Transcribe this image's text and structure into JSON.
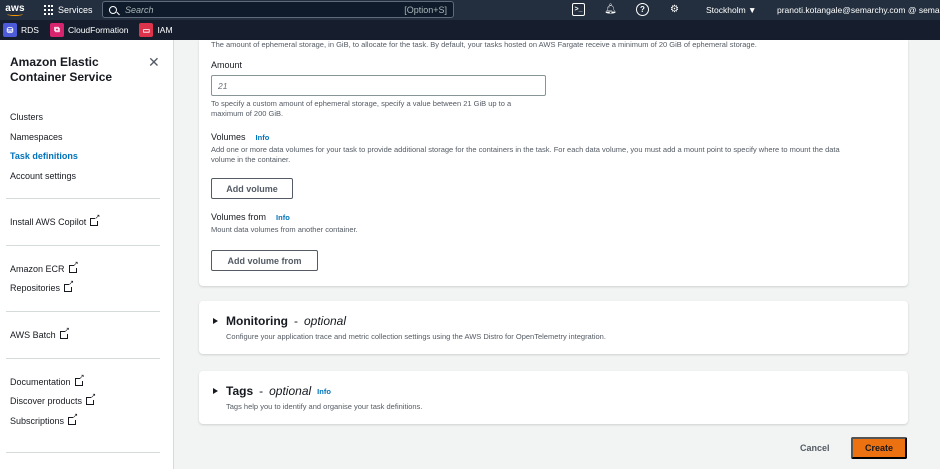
{
  "topbar": {
    "logo": "aws",
    "services_label": "Services",
    "search_placeholder": "Search",
    "search_shortcut": "[Option+S]",
    "region": "Stockholm ▼",
    "user": "pranoti.kotangale@semarchy.com @ semarch"
  },
  "favorites": [
    {
      "label": "RDS",
      "color": "#4d5bd9",
      "icon": "rds-icon"
    },
    {
      "label": "CloudFormation",
      "color": "#d6246e",
      "icon": "cloudformation-icon"
    },
    {
      "label": "IAM",
      "color": "#dd344c",
      "icon": "iam-icon"
    }
  ],
  "sidebar": {
    "title": "Amazon Elastic Container Service",
    "items": [
      "Clusters",
      "Namespaces",
      "Task definitions",
      "Account settings"
    ],
    "copilot": "Install AWS Copilot",
    "ecr": [
      "Amazon ECR",
      "Repositories"
    ],
    "batch": "AWS Batch",
    "docs": [
      "Documentation",
      "Discover products",
      "Subscriptions"
    ]
  },
  "storage": {
    "top_text": "The amount of ephemeral storage, in GiB, to allocate for the task. By default, your tasks hosted on AWS Fargate receive a minimum of 20 GiB of ephemeral storage.",
    "amount_label": "Amount",
    "amount_value": "21",
    "amount_help_1": "To specify a custom amount of ephemeral storage, specify a value between 21 GiB up to a",
    "amount_help_2": "maximum of 200 GiB."
  },
  "volumes": {
    "label": "Volumes",
    "info": "Info",
    "desc_1": "Add one or more data volumes for your task to provide additional storage for the containers in the task. For each data volume, you must add a mount point to specify where to mount the data",
    "desc_2": "volume in the container.",
    "add_button": "Add volume"
  },
  "volumes_from": {
    "label": "Volumes from",
    "info": "Info",
    "desc": "Mount data volumes from another container.",
    "add_button": "Add volume from"
  },
  "monitoring": {
    "title": "Monitoring",
    "optional": "optional",
    "desc": "Configure your application trace and metric collection settings using the AWS Distro for OpenTelemetry integration."
  },
  "tags": {
    "title": "Tags",
    "optional": "optional",
    "info": "Info",
    "desc": "Tags help you to identify and organise your task definitions."
  },
  "actions": {
    "cancel": "Cancel",
    "create": "Create"
  }
}
